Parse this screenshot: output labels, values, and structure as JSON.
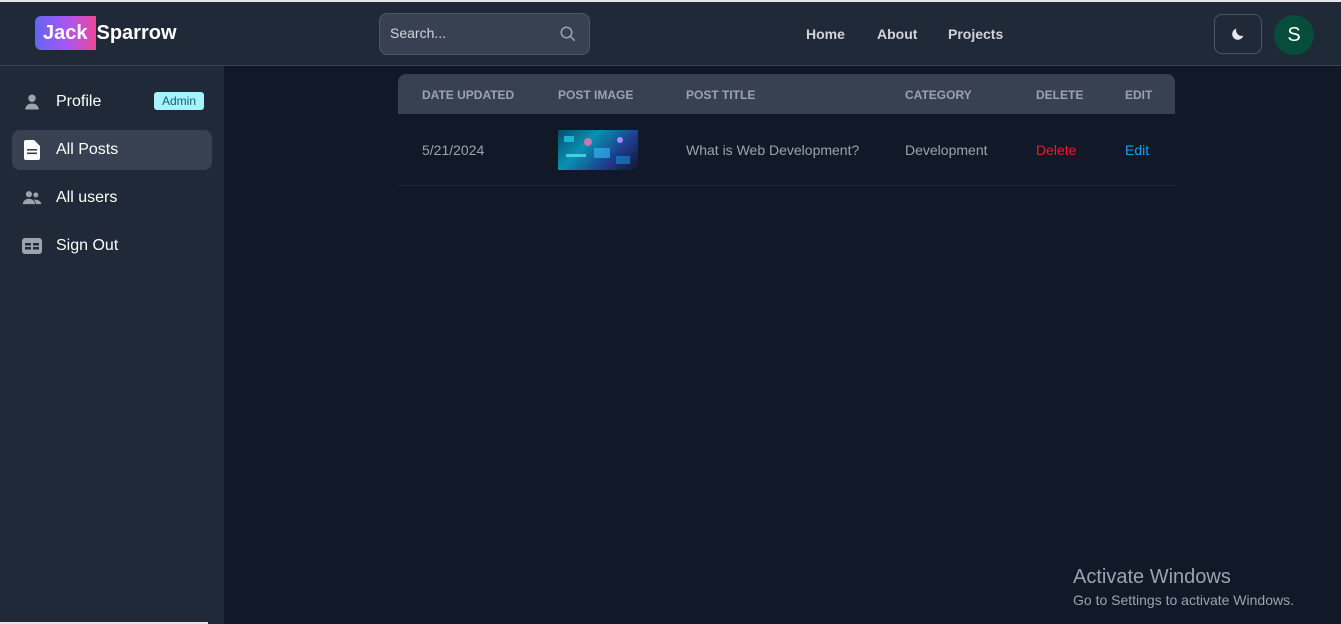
{
  "header": {
    "logo_highlight": "Jack",
    "logo_rest": "Sparrow",
    "search_placeholder": "Search...",
    "nav": [
      "Home",
      "About",
      "Projects"
    ],
    "avatar_initial": "S"
  },
  "sidebar": {
    "items": [
      {
        "label": "Profile",
        "icon": "user-icon",
        "badge": "Admin"
      },
      {
        "label": "All Posts",
        "icon": "document-icon",
        "active": true
      },
      {
        "label": "All users",
        "icon": "users-icon"
      },
      {
        "label": "Sign Out",
        "icon": "sign-out-icon"
      }
    ]
  },
  "table": {
    "headers": [
      "Date updated",
      "Post image",
      "Post title",
      "Category",
      "Delete",
      "Edit"
    ],
    "rows": [
      {
        "date": "5/21/2024",
        "title": "What is Web Development?",
        "category": "Development",
        "delete": "Delete",
        "edit": "Edit"
      }
    ]
  },
  "watermark": {
    "line1": "Activate Windows",
    "line2": "Go to Settings to activate Windows."
  },
  "colors": {
    "background": "#111827",
    "panel": "#1f2937",
    "delete": "#dc2626",
    "edit": "#0ea5e9",
    "badge": "#a5f3fc"
  }
}
